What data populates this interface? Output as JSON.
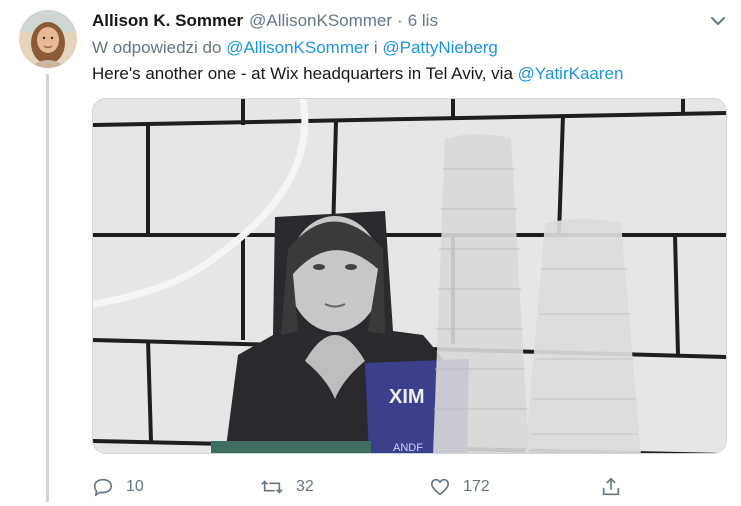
{
  "tweet": {
    "author_name": "Allison K. Sommer",
    "author_handle": "@AllisonKSommer",
    "separator": "·",
    "timestamp": "6 lis",
    "reply_prefix": "W odpowiedzi do",
    "reply_user_1": "@AllisonKSommer",
    "reply_joiner": "i",
    "reply_user_2": "@PattyNieberg",
    "text_before_mention": "Here's another one - at Wix headquarters in Tel Aviv, via",
    "text_mention": "@YatirKaaren",
    "media": {
      "cup_text": "XIM",
      "cup_bottom_text": "ANDF"
    },
    "actions": {
      "reply_count": "10",
      "retweet_count": "32",
      "like_count": "172"
    },
    "icons": [
      "avatar",
      "chevron-down-icon",
      "reply-icon",
      "retweet-icon",
      "like-icon",
      "share-icon"
    ],
    "colors": {
      "link": "#1b95e0",
      "secondary_text": "#657786",
      "primary_text": "#14171a",
      "thread_line": "#cdd6dd"
    }
  }
}
